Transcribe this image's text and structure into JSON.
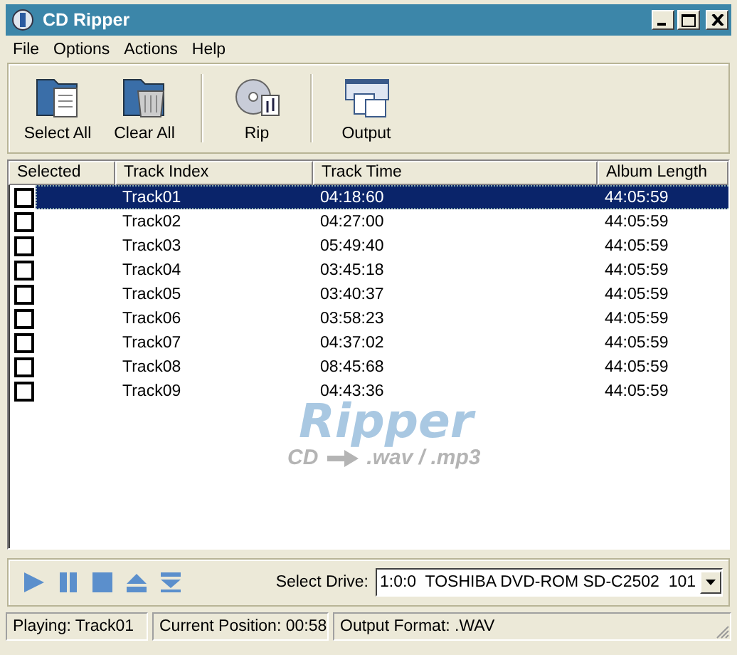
{
  "window": {
    "title": "CD Ripper"
  },
  "menu": [
    "File",
    "Options",
    "Actions",
    "Help"
  ],
  "toolbar": [
    {
      "label": "Select All",
      "kind": "select"
    },
    {
      "label": "Clear All",
      "kind": "clear"
    },
    {
      "label": "Rip",
      "kind": "rip"
    },
    {
      "label": "Output",
      "kind": "output"
    }
  ],
  "table": {
    "columns": [
      "Selected",
      "Track Index",
      "Track Time",
      "Album Length"
    ],
    "rows": [
      {
        "checked": false,
        "selected": true,
        "track": "Track01",
        "time": "04:18:60",
        "length": "44:05:59"
      },
      {
        "checked": false,
        "selected": false,
        "track": "Track02",
        "time": "04:27:00",
        "length": "44:05:59"
      },
      {
        "checked": false,
        "selected": false,
        "track": "Track03",
        "time": "05:49:40",
        "length": "44:05:59"
      },
      {
        "checked": false,
        "selected": false,
        "track": "Track04",
        "time": "03:45:18",
        "length": "44:05:59"
      },
      {
        "checked": false,
        "selected": false,
        "track": "Track05",
        "time": "03:40:37",
        "length": "44:05:59"
      },
      {
        "checked": false,
        "selected": false,
        "track": "Track06",
        "time": "03:58:23",
        "length": "44:05:59"
      },
      {
        "checked": false,
        "selected": false,
        "track": "Track07",
        "time": "04:37:02",
        "length": "44:05:59"
      },
      {
        "checked": false,
        "selected": false,
        "track": "Track08",
        "time": "08:45:68",
        "length": "44:05:59"
      },
      {
        "checked": false,
        "selected": false,
        "track": "Track09",
        "time": "04:43:36",
        "length": "44:05:59"
      }
    ]
  },
  "logo": {
    "title": "Ripper",
    "source": "CD",
    "target": ".wav / .mp3"
  },
  "transport": [
    {
      "kind": "play"
    },
    {
      "kind": "pause"
    },
    {
      "kind": "stop"
    },
    {
      "kind": "eject"
    },
    {
      "kind": "load"
    }
  ],
  "drive": {
    "label": "Select Drive:",
    "value": "1:0:0  TOSHIBA DVD-ROM SD-C2502",
    "revision": "101"
  },
  "status_bar": [
    "Playing: Track01",
    "Current Position: 00:58",
    "Output Format: .WAV"
  ]
}
